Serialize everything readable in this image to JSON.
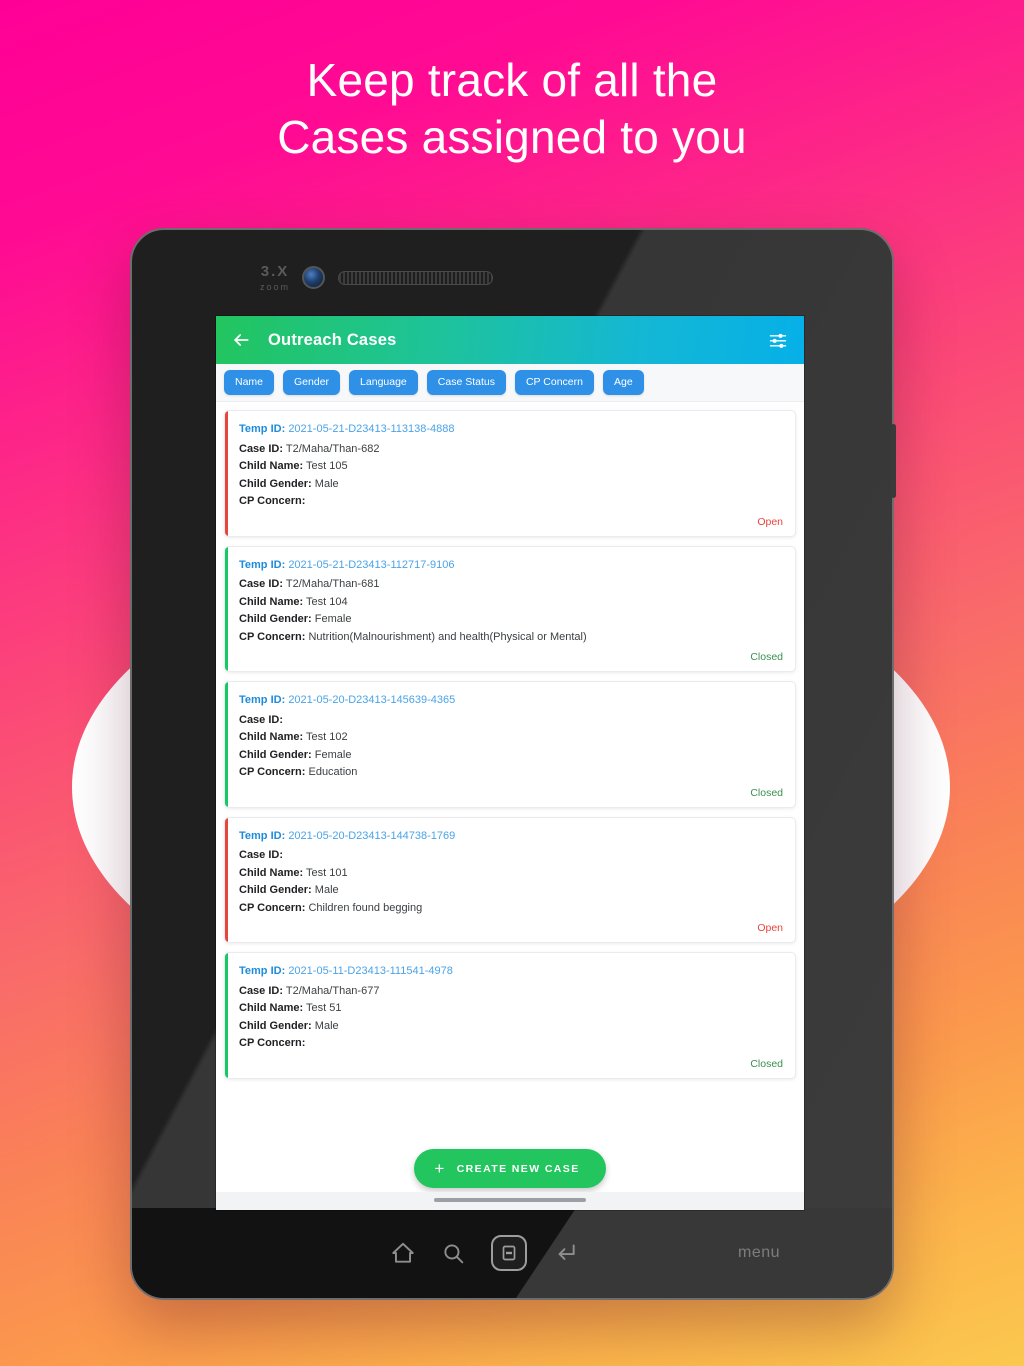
{
  "promo": {
    "headline": "Keep track of all the\nCases assigned to you",
    "bg_gradient_from": "#ff0096",
    "bg_gradient_to": "#fbc84e"
  },
  "device": {
    "camera_label": "3.X",
    "camera_sublabel": "zoom",
    "nav": {
      "home_icon": "home-icon",
      "search_icon": "search-icon",
      "recents_icon": "recents-icon",
      "back_icon": "back-icon",
      "menu_label": "menu"
    }
  },
  "app": {
    "appbar": {
      "back_icon": "arrow-left-icon",
      "title": "Outreach Cases",
      "filter_icon": "tune-icon",
      "gradient_from": "#22c55e",
      "gradient_to": "#06b0e8"
    },
    "chips": [
      {
        "label": "Name"
      },
      {
        "label": "Gender"
      },
      {
        "label": "Language"
      },
      {
        "label": "Case Status"
      },
      {
        "label": "CP Concern"
      },
      {
        "label": "Age"
      }
    ],
    "chip_color": "#2f90e8",
    "field_labels": {
      "temp_id": "Temp ID:",
      "case_id": "Case ID:",
      "child_name": "Child Name:",
      "child_gender": "Child Gender:",
      "cp_concern": "CP Concern:"
    },
    "cases": [
      {
        "temp_id": "2021-05-21-D23413-113138-4888",
        "case_id": "T2/Maha/Than-682",
        "child_name": "Test 105",
        "child_gender": "Male",
        "cp_concern": "",
        "status": "Open",
        "status_kind": "open"
      },
      {
        "temp_id": "2021-05-21-D23413-112717-9106",
        "case_id": "T2/Maha/Than-681",
        "child_name": "Test 104",
        "child_gender": "Female",
        "cp_concern": "Nutrition(Malnourishment) and health(Physical or Mental)",
        "status": "Closed",
        "status_kind": "closed"
      },
      {
        "temp_id": "2021-05-20-D23413-145639-4365",
        "case_id": "",
        "child_name": "Test 102",
        "child_gender": "Female",
        "cp_concern": "Education",
        "status": "Closed",
        "status_kind": "closed"
      },
      {
        "temp_id": "2021-05-20-D23413-144738-1769",
        "case_id": "",
        "child_name": "Test 101",
        "child_gender": "Male",
        "cp_concern": "Children found begging",
        "status": "Open",
        "status_kind": "open"
      },
      {
        "temp_id": "2021-05-11-D23413-111541-4978",
        "case_id": "T2/Maha/Than-677",
        "child_name": "Test 51",
        "child_gender": "Male",
        "cp_concern": "",
        "status": "Closed",
        "status_kind": "closed"
      }
    ],
    "fab": {
      "plus_icon": "plus-icon",
      "label": "CREATE NEW CASE",
      "color": "#22c55e"
    },
    "status_colors": {
      "open": "#e8453c",
      "closed": "#3b8f4e"
    }
  }
}
